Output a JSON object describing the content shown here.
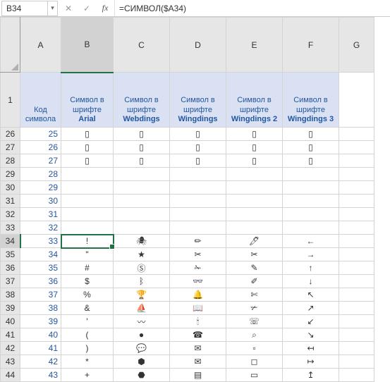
{
  "formula_bar": {
    "name_box": "B34",
    "cancel": "✕",
    "ok": "✓",
    "fx": "fx",
    "formula": "=СИМВОЛ($A34)"
  },
  "columns": [
    "A",
    "B",
    "C",
    "D",
    "E",
    "F",
    "G"
  ],
  "header_row": {
    "number": "1",
    "cells": [
      {
        "line1": "Код",
        "line2": "символа"
      },
      {
        "line1": "Символ в",
        "line2_pre": "шрифте ",
        "line2_b": "Arial"
      },
      {
        "line1": "Символ в",
        "line2": "шрифте",
        "line3_b": "Webdings"
      },
      {
        "line1": "Символ в",
        "line2": "шрифте",
        "line3_b": "Wingdings"
      },
      {
        "line1": "Символ в",
        "line2": "шрифте",
        "line3_b": "Wingdings 2"
      },
      {
        "line1": "Символ в",
        "line2": "шрифте",
        "line3_b": "Wingdings 3"
      }
    ]
  },
  "rows": [
    {
      "n": "26",
      "code": "25",
      "b": "▯",
      "c": "▯",
      "d": "▯",
      "e": "▯",
      "f": "▯"
    },
    {
      "n": "27",
      "code": "26",
      "b": "▯",
      "c": "▯",
      "d": "▯",
      "e": "▯",
      "f": "▯"
    },
    {
      "n": "28",
      "code": "27",
      "b": "▯",
      "c": "▯",
      "d": "▯",
      "e": "▯",
      "f": "▯"
    },
    {
      "n": "29",
      "code": "28",
      "b": "",
      "c": "",
      "d": "",
      "e": "",
      "f": ""
    },
    {
      "n": "30",
      "code": "29",
      "b": "",
      "c": "",
      "d": "",
      "e": "",
      "f": ""
    },
    {
      "n": "31",
      "code": "30",
      "b": "",
      "c": "",
      "d": "",
      "e": "",
      "f": ""
    },
    {
      "n": "32",
      "code": "31",
      "b": "",
      "c": "",
      "d": "",
      "e": "",
      "f": ""
    },
    {
      "n": "33",
      "code": "32",
      "b": "",
      "c": "",
      "d": "",
      "e": "",
      "f": ""
    },
    {
      "n": "34",
      "code": "33",
      "b": "!",
      "c": "🕷",
      "d": "✏",
      "e": "🖊",
      "f": "←",
      "active": true
    },
    {
      "n": "35",
      "code": "34",
      "b": "\"",
      "c": "★",
      "d": "✂",
      "e": "✂",
      "f": "→"
    },
    {
      "n": "36",
      "code": "35",
      "b": "#",
      "c": "Ⓢ",
      "d": "✁",
      "e": "✎",
      "f": "↑"
    },
    {
      "n": "37",
      "code": "36",
      "b": "$",
      "c": "ᛒ",
      "d": "👓",
      "e": "✐",
      "f": "↓"
    },
    {
      "n": "38",
      "code": "37",
      "b": "%",
      "c": "🏆",
      "d": "🔔",
      "e": "✄",
      "f": "↖"
    },
    {
      "n": "39",
      "code": "38",
      "b": "&",
      "c": "⛵",
      "d": "📖",
      "e": "✃",
      "f": "↗"
    },
    {
      "n": "40",
      "code": "39",
      "b": "'",
      "c": "〰",
      "d": "🕯",
      "e": "☏",
      "f": "↙"
    },
    {
      "n": "41",
      "code": "40",
      "b": "(",
      "c": "●",
      "d": "☎",
      "e": "⌕",
      "f": "↘"
    },
    {
      "n": "42",
      "code": "41",
      "b": ")",
      "c": "💬",
      "d": "✉",
      "e": "▫",
      "f": "↤"
    },
    {
      "n": "43",
      "code": "42",
      "b": "*",
      "c": "⬢",
      "d": "✉",
      "e": "◻",
      "f": "↦"
    },
    {
      "n": "44",
      "code": "43",
      "b": "+",
      "c": "⬣",
      "d": "▤",
      "e": "▭",
      "f": "↥"
    }
  ]
}
